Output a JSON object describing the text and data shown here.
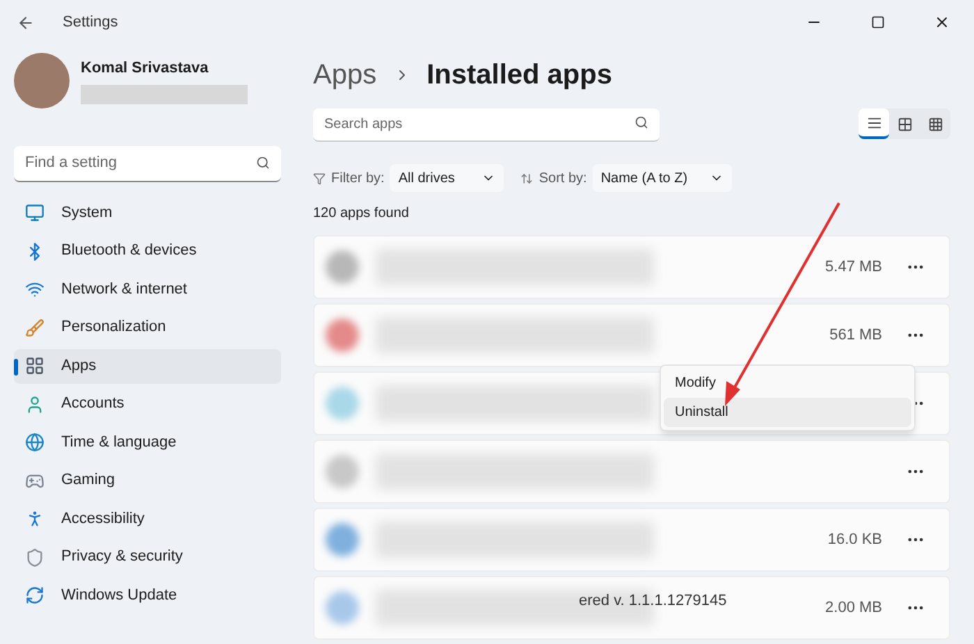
{
  "window": {
    "title": "Settings"
  },
  "user": {
    "name": "Komal Srivastava"
  },
  "sidebar": {
    "search": {
      "placeholder": "Find a setting"
    },
    "items": [
      {
        "label": "System",
        "kind": "system",
        "selected": false
      },
      {
        "label": "Bluetooth & devices",
        "kind": "bluetooth",
        "selected": false
      },
      {
        "label": "Network & internet",
        "kind": "network",
        "selected": false
      },
      {
        "label": "Personalization",
        "kind": "brush",
        "selected": false
      },
      {
        "label": "Apps",
        "kind": "apps",
        "selected": true
      },
      {
        "label": "Accounts",
        "kind": "person",
        "selected": false
      },
      {
        "label": "Time & language",
        "kind": "globe",
        "selected": false
      },
      {
        "label": "Gaming",
        "kind": "gamepad",
        "selected": false
      },
      {
        "label": "Accessibility",
        "kind": "accessibility",
        "selected": false
      },
      {
        "label": "Privacy & security",
        "kind": "shield",
        "selected": false
      },
      {
        "label": "Windows Update",
        "kind": "update",
        "selected": false
      }
    ]
  },
  "breadcrumb": {
    "parent": "Apps",
    "current": "Installed apps"
  },
  "search": {
    "placeholder": "Search apps"
  },
  "view_modes": [
    {
      "kind": "list",
      "selected": true
    },
    {
      "kind": "tiles",
      "selected": false
    },
    {
      "kind": "grid",
      "selected": false
    }
  ],
  "filter": {
    "label": "Filter by:",
    "value": "All drives"
  },
  "sort": {
    "label": "Sort by:",
    "value": "Name (A to Z)"
  },
  "count": "120 apps found",
  "apps": [
    {
      "size": "5.47 MB",
      "color": "#b8b8b8"
    },
    {
      "size": "561 MB",
      "color": "#e58a8a"
    },
    {
      "color": "#a9d8e8"
    },
    {
      "color": "#c8c8c8"
    },
    {
      "size": "16.0 KB",
      "color": "#7fb0de"
    },
    {
      "size": "2.00 MB",
      "detail": "ered v. 1.1.1.1279145",
      "color": "#a8c8ea"
    }
  ],
  "context_menu": {
    "items": [
      {
        "label": "Modify",
        "selected": false
      },
      {
        "label": "Uninstall",
        "selected": true
      }
    ]
  }
}
